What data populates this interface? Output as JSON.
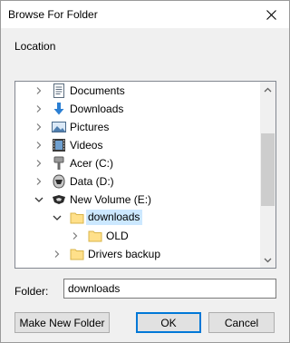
{
  "dialog": {
    "title": "Browse For Folder",
    "close_glyph": "✕",
    "location_label": "Location"
  },
  "tree": {
    "items": [
      {
        "label": "Documents",
        "icon": "documents-icon",
        "expanded": false
      },
      {
        "label": "Downloads",
        "icon": "downloads-icon",
        "expanded": false
      },
      {
        "label": "Pictures",
        "icon": "pictures-icon",
        "expanded": false
      },
      {
        "label": "Videos",
        "icon": "videos-icon",
        "expanded": false
      },
      {
        "label": "Acer (C:)",
        "icon": "drive-c-icon",
        "expanded": false
      },
      {
        "label": "Data (D:)",
        "icon": "drive-d-icon",
        "expanded": false
      },
      {
        "label": "New Volume (E:)",
        "icon": "drive-e-icon",
        "expanded": true
      },
      {
        "label": "downloads",
        "icon": "folder-icon",
        "expanded": true,
        "selected": true
      },
      {
        "label": "OLD",
        "icon": "folder-icon",
        "expanded": false
      },
      {
        "label": "Drivers backup",
        "icon": "folder-icon",
        "expanded": false
      }
    ]
  },
  "folder_field": {
    "label": "Folder:",
    "value": "downloads"
  },
  "buttons": {
    "make_new_folder": "Make New Folder",
    "ok": "OK",
    "cancel": "Cancel"
  },
  "colors": {
    "selection": "#cce8ff",
    "folder": "#ffe08a",
    "accent": "#0078d7"
  }
}
